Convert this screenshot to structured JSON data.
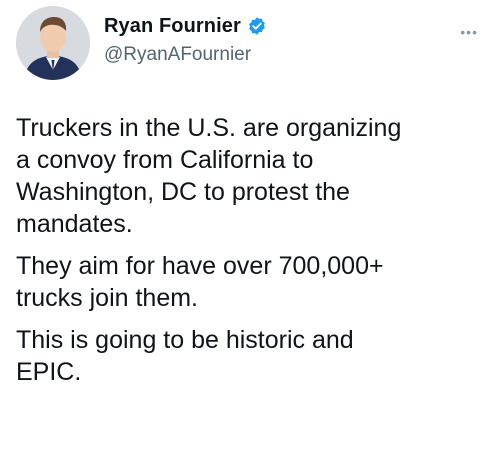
{
  "author": {
    "display_name": "Ryan Fournier",
    "handle": "@RyanAFournier",
    "verified": true,
    "avatar": "avatar-photo"
  },
  "menu": {
    "icon": "more-horizontal-icon",
    "glyph": "•••"
  },
  "tweet": {
    "paragraphs": [
      "Truckers in the U.S. are organizing\na convoy from California to\nWashington, DC to protest the\nmandates.",
      "They aim for have over 700,000+\ntrucks join them.",
      "This is going to be historic and\nEPIC."
    ]
  },
  "colors": {
    "verified_badge": "#1d9bf0",
    "text": "#0f1419",
    "secondary_text": "#536471"
  }
}
